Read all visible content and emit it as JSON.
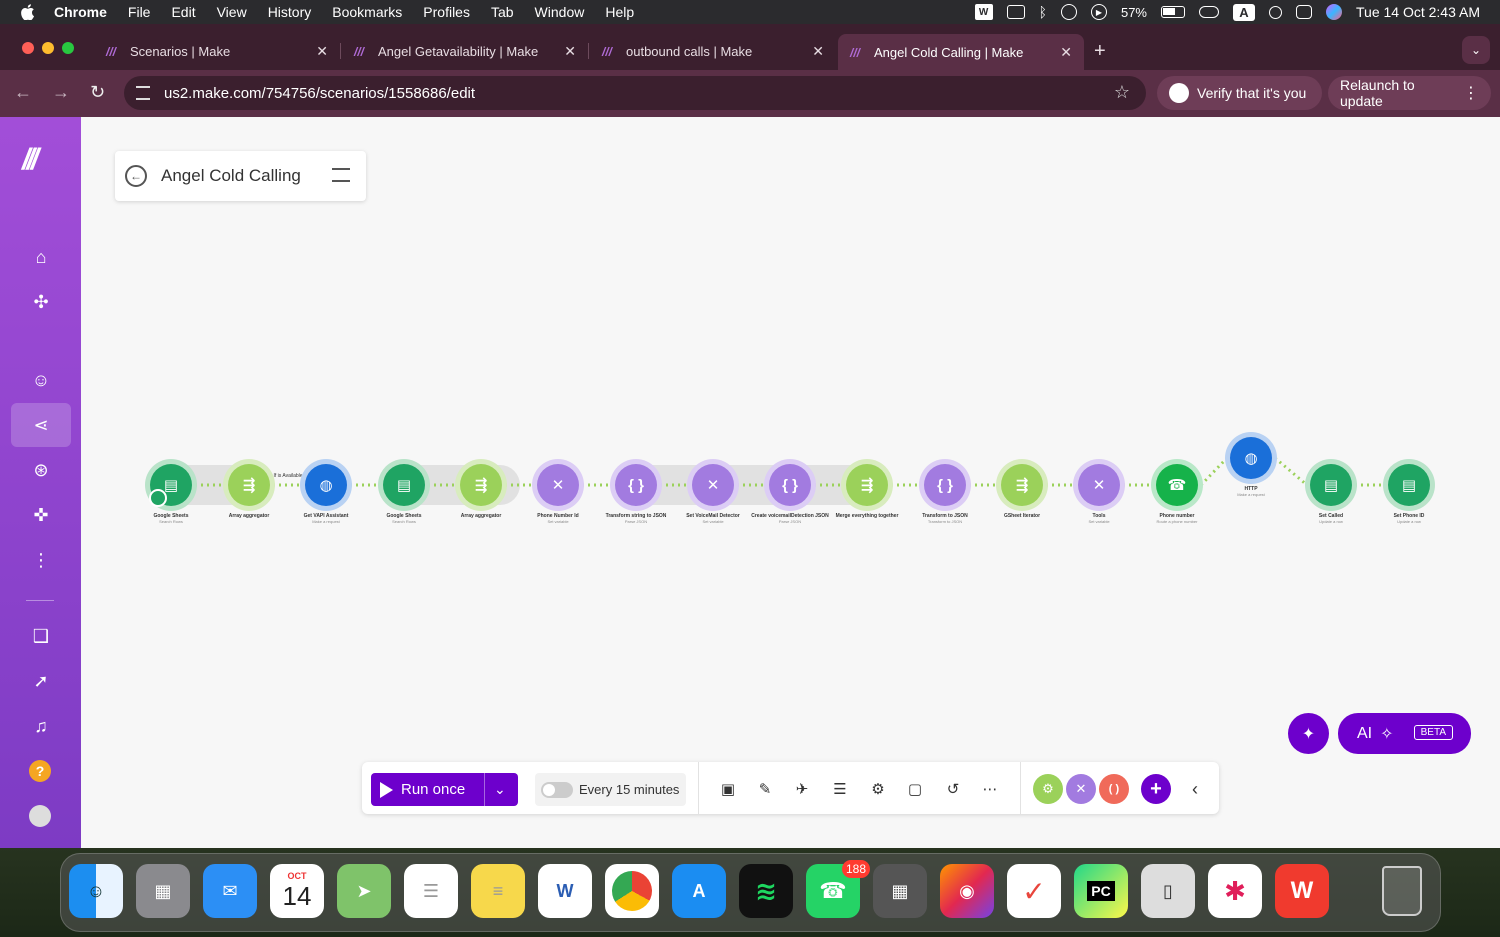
{
  "menubar": {
    "app": "Chrome",
    "items": [
      "File",
      "Edit",
      "View",
      "History",
      "Bookmarks",
      "Profiles",
      "Tab",
      "Window",
      "Help"
    ],
    "battery": "57%",
    "input_source": "A",
    "datetime": "Tue 14 Oct  2:43 AM"
  },
  "tabs": [
    {
      "label": "Scenarios | Make"
    },
    {
      "label": "Angel Getavailability | Make"
    },
    {
      "label": "outbound calls | Make"
    },
    {
      "label": "Angel Cold Calling | Make"
    }
  ],
  "address": {
    "url": "us2.make.com/754756/scenarios/1558686/edit"
  },
  "pills": {
    "verify": "Verify that it's you",
    "relaunch": "Relaunch to update"
  },
  "scenario": {
    "title": "Angel Cold Calling"
  },
  "modules": [
    {
      "name": "Google Sheets",
      "sub": "Search Rows",
      "kind": "sheets"
    },
    {
      "name": "Array aggregator",
      "sub": "",
      "kind": "agg"
    },
    {
      "name": "Get VAPI Assistant",
      "sub": "Make a request",
      "kind": "http"
    },
    {
      "name": "Google Sheets",
      "sub": "Search Rows",
      "kind": "sheets"
    },
    {
      "name": "Array aggregator",
      "sub": "",
      "kind": "agg"
    },
    {
      "name": "Phone Number Id",
      "sub": "Set variable",
      "kind": "tool"
    },
    {
      "name": "Transform string to JSON",
      "sub": "Parse JSON",
      "kind": "json"
    },
    {
      "name": "Set VoiceMail Detector",
      "sub": "Set variable",
      "kind": "tool"
    },
    {
      "name": "Create voicemailDetection JSON",
      "sub": "Parse JSON",
      "kind": "json"
    },
    {
      "name": "Merge everything together",
      "sub": "",
      "kind": "agg"
    },
    {
      "name": "Transform to JSON",
      "sub": "Transform to JSON",
      "kind": "json"
    },
    {
      "name": "GSheet Iterator",
      "sub": "",
      "kind": "agg"
    },
    {
      "name": "Tools",
      "sub": "Set variable",
      "kind": "tool"
    },
    {
      "name": "Phone number",
      "sub": "Route a phone number",
      "kind": "phone"
    },
    {
      "name": "HTTP",
      "sub": "Make a request",
      "kind": "http"
    },
    {
      "name": "Set Called",
      "sub": "Update a row",
      "kind": "sheets"
    },
    {
      "name": "Set Phone ID",
      "sub": "Update a row",
      "kind": "sheets"
    }
  ],
  "filter_label": "If is Available",
  "bottombar": {
    "run_label": "Run once",
    "schedule_label": "Every 15 minutes"
  },
  "ai": {
    "label": "AI",
    "beta": "BETA"
  },
  "dock": {
    "calendar_month": "OCT",
    "calendar_day": "14",
    "whatsapp_badge": "188"
  },
  "colors": {
    "make_purple": "#6d00cc",
    "sidebar_top": "#a24ed8",
    "sidebar_bottom": "#7d3bc4",
    "sheets_green": "#1fa463",
    "aggregator_green": "#9bd15a",
    "http_blue": "#1a6fd9",
    "tool_purple": "#a27be0"
  }
}
